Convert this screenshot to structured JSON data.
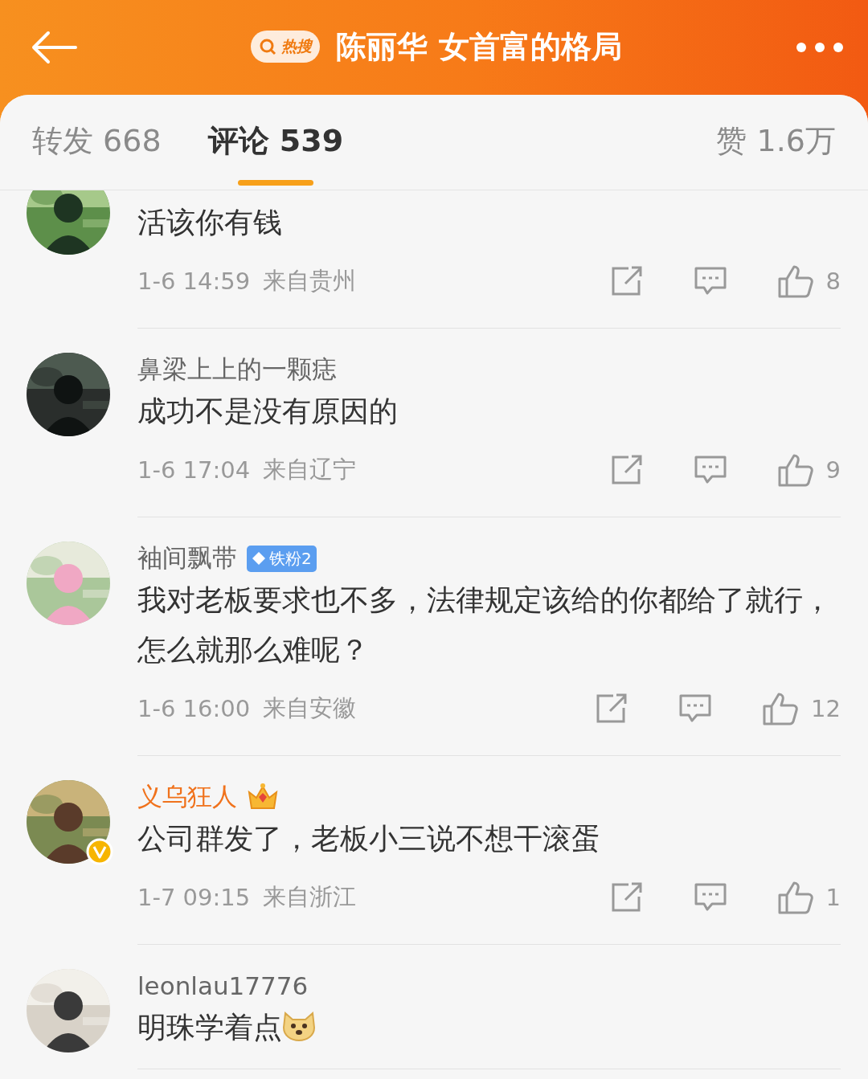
{
  "header": {
    "badge": "热搜",
    "title": "陈丽华 女首富的格局"
  },
  "tabs": [
    {
      "label": "转发 668",
      "selected": false
    },
    {
      "label": "评论 539",
      "selected": true
    },
    {
      "label": "赞 1.6万",
      "selected": false
    }
  ],
  "comments": [
    {
      "content": "活该你有钱",
      "time": "1-6 14:59",
      "location": "来自贵州",
      "likes": "8"
    },
    {
      "name": "鼻梁上上的一颗痣",
      "content": "成功不是没有原因的",
      "time": "1-6 17:04",
      "location": "来自辽宁",
      "likes": "9"
    },
    {
      "name": "袖间飘带",
      "badge": "铁粉2",
      "content": "我对老板要求也不多，法律规定该给的你都给了就行，怎么就那么难呢？",
      "time": "1-6 16:00",
      "location": "来自安徽",
      "likes": "12"
    },
    {
      "name": "义乌狂人",
      "vip": true,
      "verified": true,
      "content": "公司群发了，老板小三说不想干滚蛋",
      "time": "1-7 09:15",
      "location": "来自浙江",
      "likes": "1"
    },
    {
      "name": "leonlau17776",
      "content": "明珠学着点",
      "emoji": true
    }
  ]
}
